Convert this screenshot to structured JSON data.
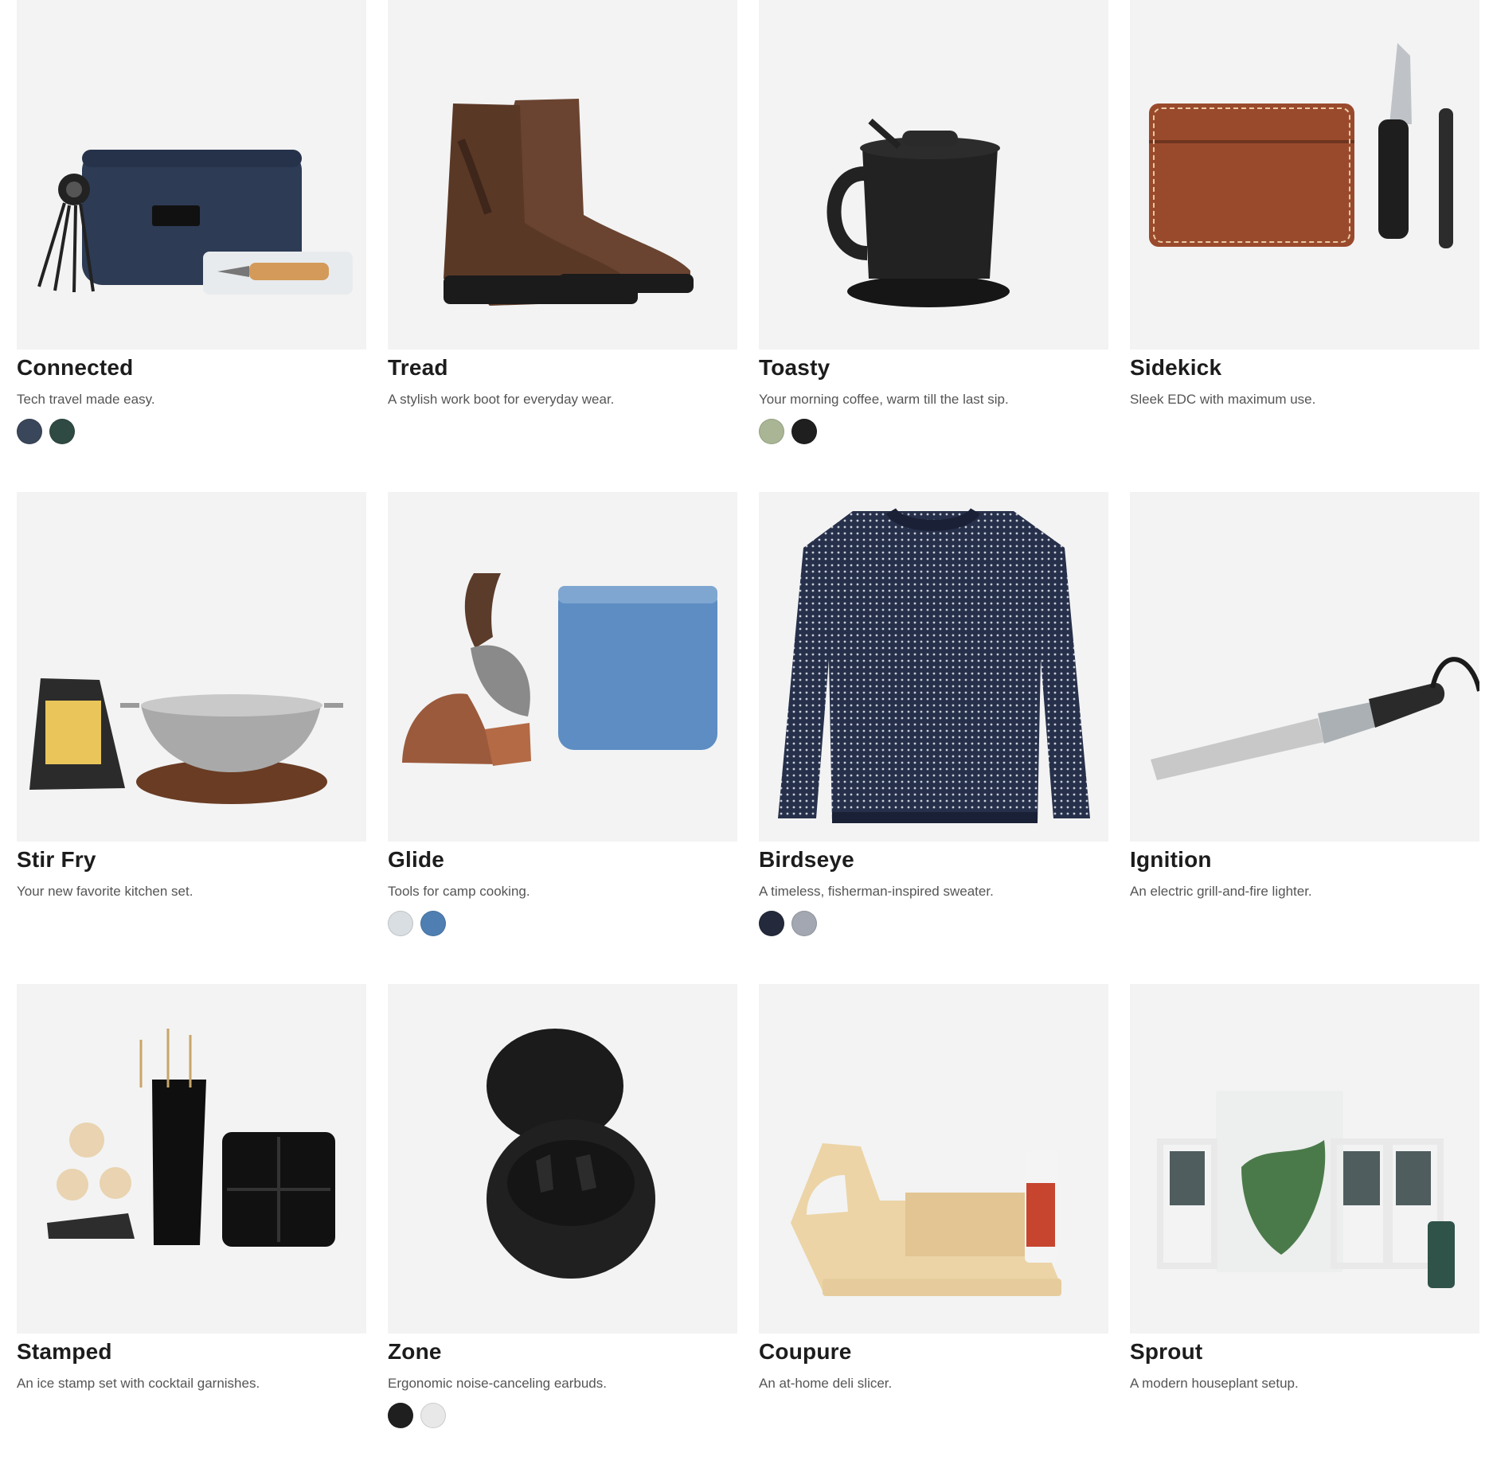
{
  "products": [
    {
      "title": "Connected",
      "description": "Tech travel made easy.",
      "icon": "tech-pouch-icon",
      "swatches": [
        "#3a4659",
        "#2f4a42"
      ]
    },
    {
      "title": "Tread",
      "description": "A stylish work boot for everyday wear.",
      "icon": "boots-icon",
      "swatches": []
    },
    {
      "title": "Toasty",
      "description": "Your morning coffee, warm till the last sip.",
      "icon": "mug-icon",
      "swatches": [
        "#a9b594",
        "#1f1f1f"
      ]
    },
    {
      "title": "Sidekick",
      "description": "Sleek EDC with maximum use.",
      "icon": "wallet-knife-icon",
      "swatches": []
    },
    {
      "title": "Stir Fry",
      "description": "Your new favorite kitchen set.",
      "icon": "wok-icon",
      "swatches": []
    },
    {
      "title": "Glide",
      "description": "Tools for camp cooking.",
      "icon": "knife-bag-icon",
      "swatches": [
        "#d9dee2",
        "#4f7fb2"
      ]
    },
    {
      "title": "Birdseye",
      "description": "A timeless, fisherman-inspired sweater.",
      "icon": "sweater-icon",
      "swatches": [
        "#242a3c",
        "#a3a7b1"
      ]
    },
    {
      "title": "Ignition",
      "description": "An electric grill-and-fire lighter.",
      "icon": "fire-lighter-icon",
      "swatches": []
    },
    {
      "title": "Stamped",
      "description": "An ice stamp set with cocktail garnishes.",
      "icon": "ice-stamp-icon",
      "swatches": []
    },
    {
      "title": "Zone",
      "description": "Ergonomic noise-canceling earbuds.",
      "icon": "earbuds-icon",
      "swatches": [
        "#1f1f1f",
        "#e8e8e8"
      ]
    },
    {
      "title": "Coupure",
      "description": "An at-home deli slicer.",
      "icon": "deli-slicer-icon",
      "swatches": []
    },
    {
      "title": "Sprout",
      "description": "A modern houseplant setup.",
      "icon": "planter-icon",
      "swatches": []
    }
  ]
}
